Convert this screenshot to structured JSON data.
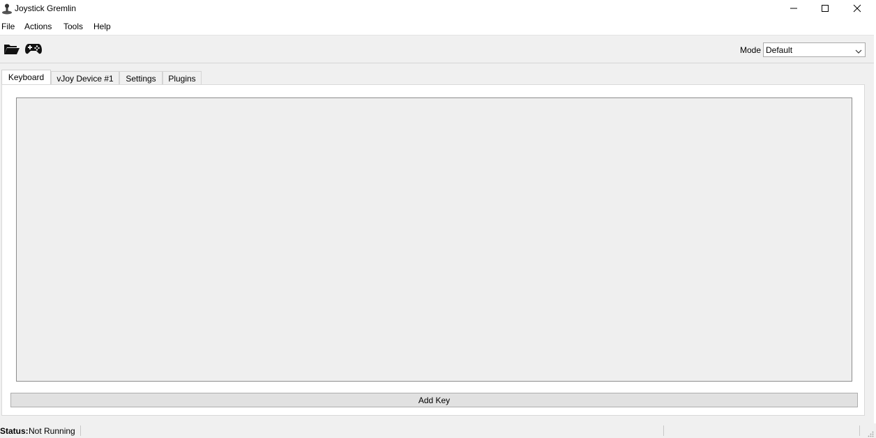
{
  "window": {
    "title": "Joystick Gremlin",
    "controls": [
      "minimize-icon",
      "maximize-icon",
      "close-icon"
    ]
  },
  "menu": {
    "items": [
      "File",
      "Actions",
      "Tools",
      "Help"
    ]
  },
  "toolbar": {
    "icons": [
      "open-folder-icon",
      "gamepad-icon"
    ],
    "mode_label": "Mode",
    "mode_value": "Default"
  },
  "tabs": [
    {
      "label": "Keyboard",
      "active": true
    },
    {
      "label": "vJoy Device #1",
      "active": false
    },
    {
      "label": "Settings",
      "active": false
    },
    {
      "label": "Plugins",
      "active": false
    }
  ],
  "panel": {
    "add_key_label": "Add Key"
  },
  "status": {
    "label": "Status:",
    "value": "Not Running"
  }
}
